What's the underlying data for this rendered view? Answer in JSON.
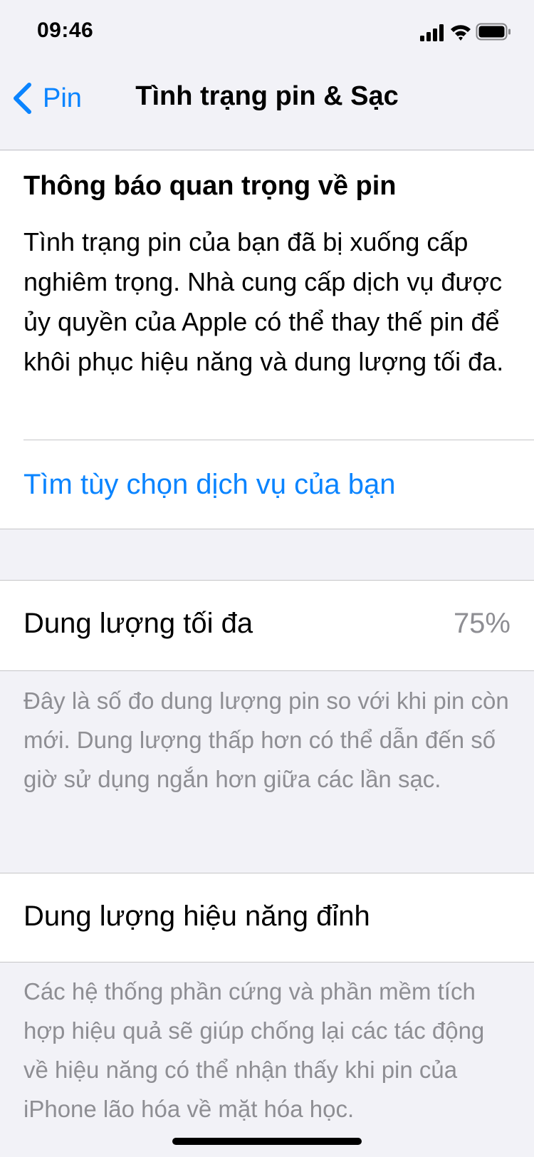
{
  "status_bar": {
    "time": "09:46",
    "icons": [
      "cellular-signal-icon",
      "wifi-icon",
      "battery-icon"
    ]
  },
  "nav": {
    "back_label": "Pin",
    "title": "Tình trạng pin & Sạc"
  },
  "notice": {
    "title": "Thông báo quan trọng về pin",
    "body": "Tình trạng pin của bạn đã bị xuống cấp nghiêm trọng. Nhà cung cấp dịch vụ được ủy quyền của Apple có thể thay thế pin để khôi phục hiệu năng và dung lượng tối đa.",
    "link": "Tìm tùy chọn dịch vụ của bạn"
  },
  "maximum_capacity": {
    "label": "Dung lượng tối đa",
    "value": "75%",
    "footnote": "Đây là số đo dung lượng pin so với khi pin còn mới. Dung lượng thấp hơn có thể dẫn đến số giờ sử dụng ngắn hơn giữa các lần sạc."
  },
  "peak_performance": {
    "label": "Dung lượng hiệu năng đỉnh",
    "footnote": "Các hệ thống phần cứng và phần mềm tích hợp hiệu quả sẽ giúp chống lại các tác động về hiệu năng có thể nhận thấy khi pin của iPhone lão hóa về mặt hóa học."
  },
  "colors": {
    "accent": "#0a84ff",
    "background": "#f2f2f7",
    "secondary_text": "#8e8e93",
    "separator": "#c6c6c8"
  }
}
